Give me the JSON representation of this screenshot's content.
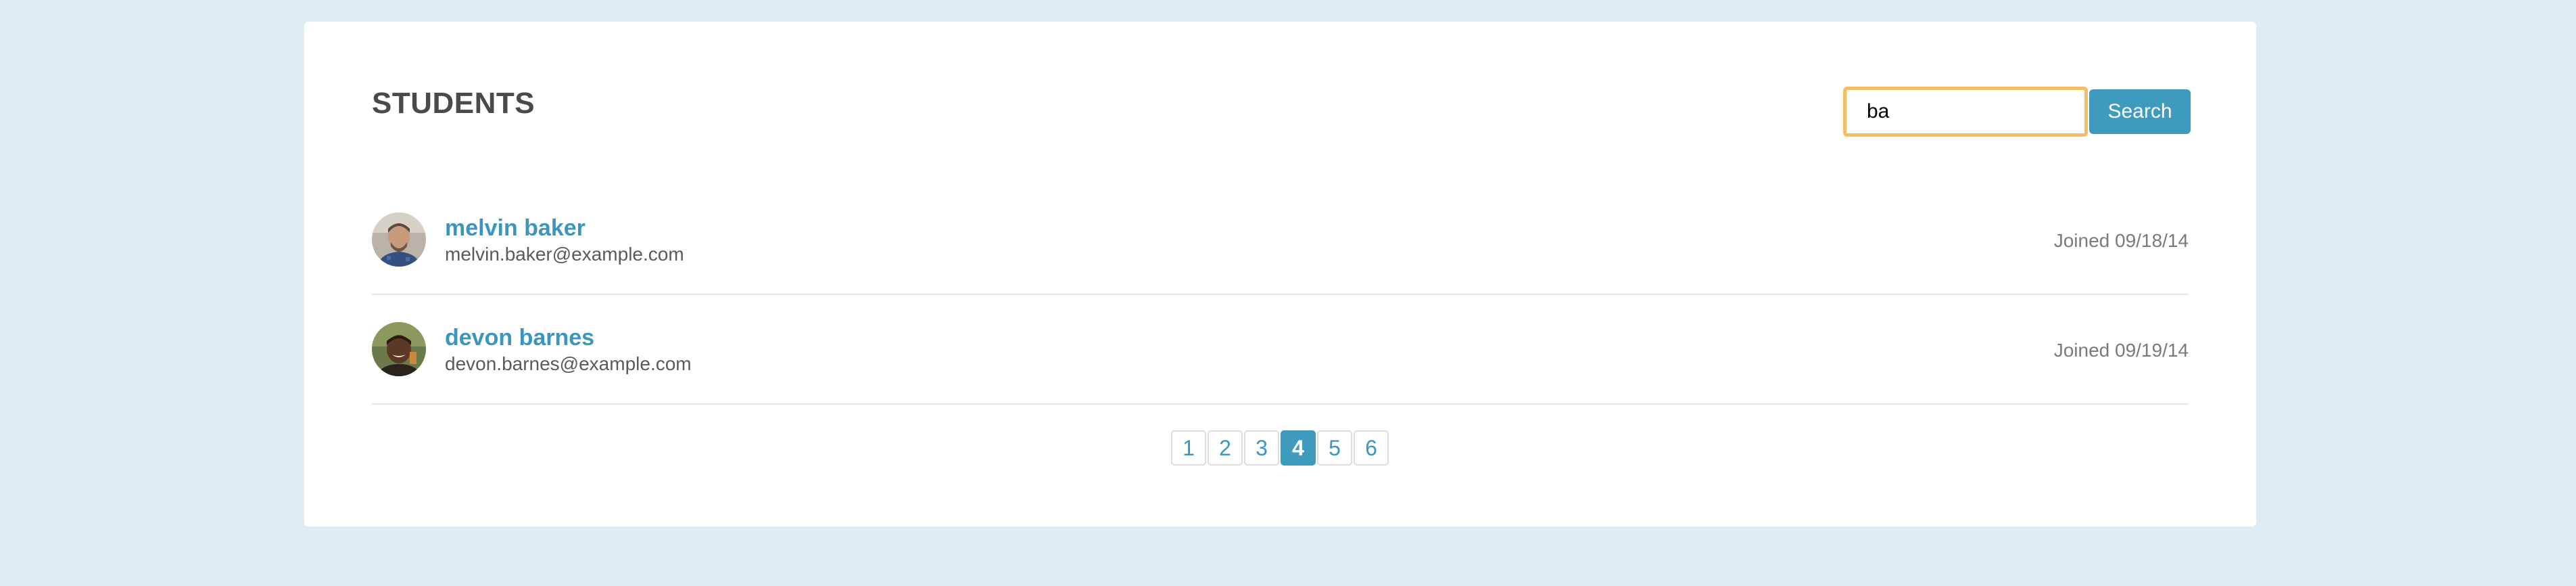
{
  "header": {
    "title": "STUDENTS"
  },
  "search": {
    "value": "ba",
    "button_label": "Search"
  },
  "students": [
    {
      "name": "melvin baker",
      "email": "melvin.baker@example.com",
      "joined": "Joined 09/18/14",
      "avatar_icon": "avatar-photo"
    },
    {
      "name": "devon barnes",
      "email": "devon.barnes@example.com",
      "joined": "Joined 09/19/14",
      "avatar_icon": "avatar-photo"
    }
  ],
  "pagination": {
    "pages": [
      "1",
      "2",
      "3",
      "4",
      "5",
      "6"
    ],
    "current": "4"
  },
  "colors": {
    "background": "#dfedf3",
    "accent": "#3f9bbd",
    "link": "#3b96bf",
    "focus_border": "#f6bd62"
  }
}
